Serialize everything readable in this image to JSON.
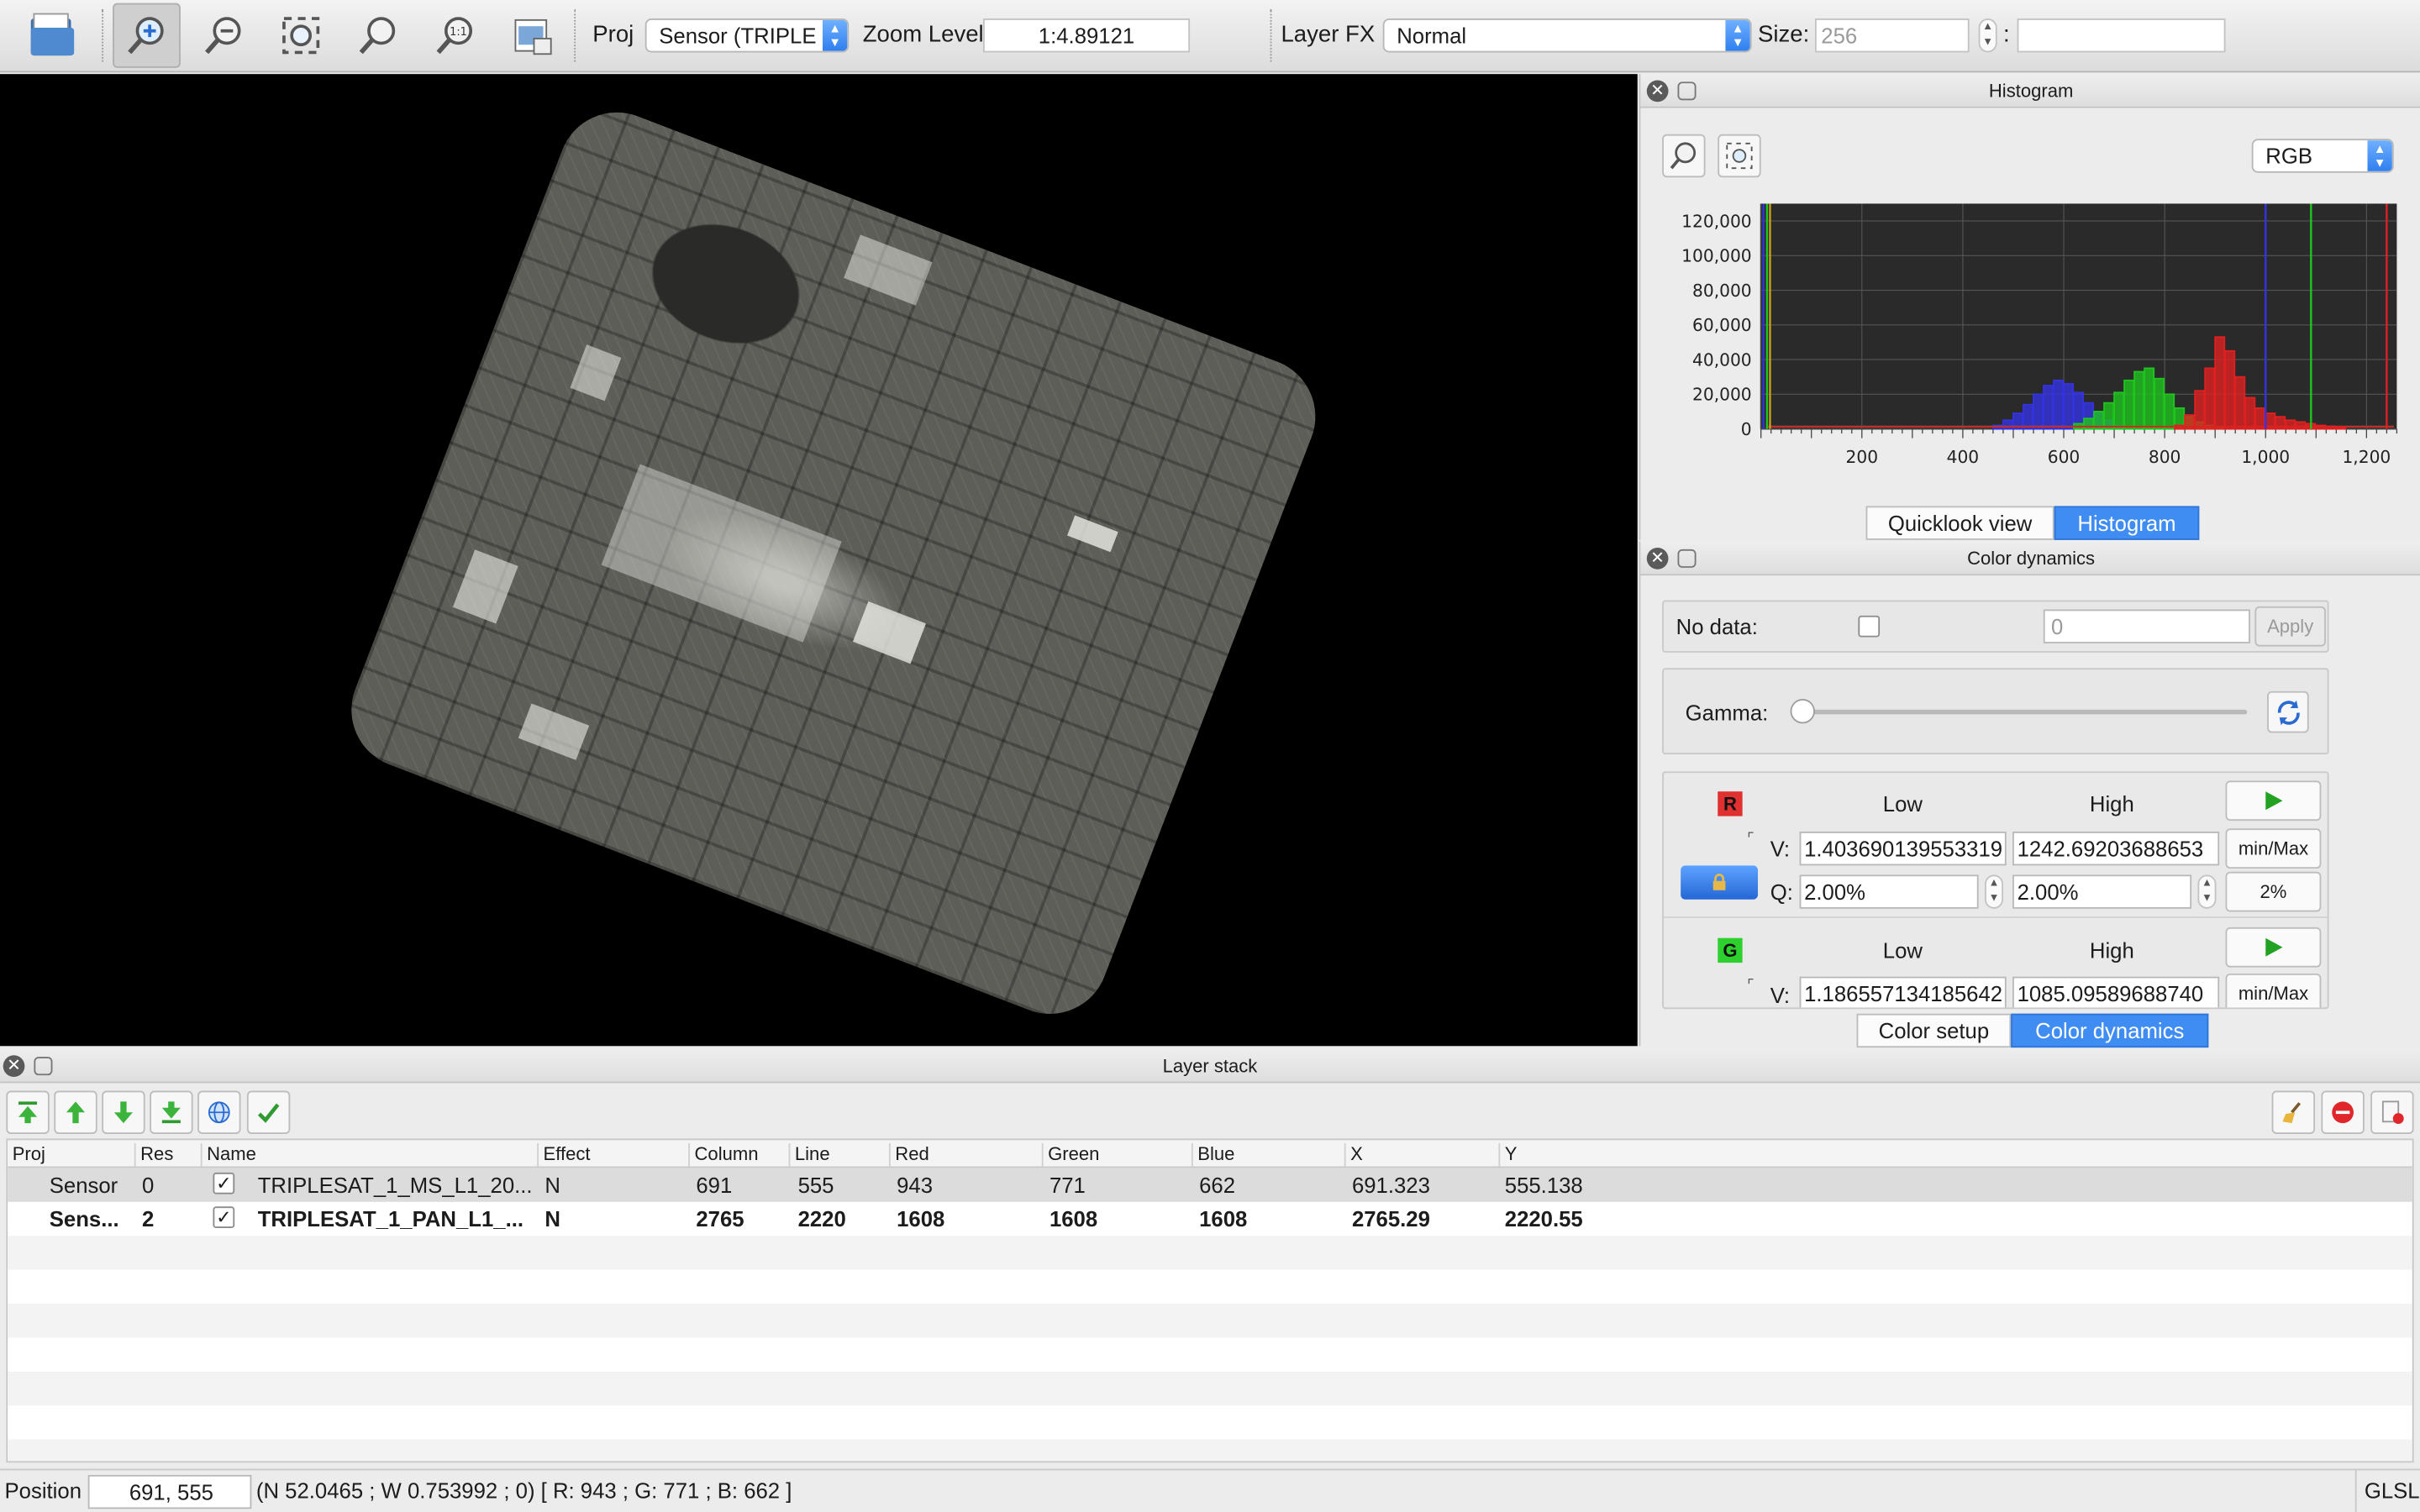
{
  "toolbar": {
    "proj_label": "Proj",
    "proj_value": "Sensor (TRIPLE",
    "zoom_label": "Zoom Level",
    "zoom_value": "1:4.89121",
    "layerfx_label": "Layer FX",
    "layerfx_value": "Normal",
    "size_label": "Size:",
    "size_value": "256",
    "size_sep": ":",
    "size_value2": ""
  },
  "histogram": {
    "title": "Histogram",
    "mode": "RGB",
    "y_ticks": [
      "120,000",
      "100,000",
      "80,000",
      "60,000",
      "40,000",
      "20,000",
      "0"
    ],
    "x_ticks": [
      "200",
      "400",
      "600",
      "800",
      "1,000",
      "1,200"
    ],
    "tabs": [
      "Quicklook view",
      "Histogram"
    ],
    "active_tab": "Histogram",
    "colors": {
      "red": "#e02020",
      "green": "#1fc41f",
      "blue": "#3333e0"
    }
  },
  "chart_data": {
    "type": "bar",
    "xlim": [
      0,
      1260
    ],
    "ylim": [
      0,
      130000
    ],
    "series": [
      {
        "name": "R",
        "x": [
          820,
          840,
          860,
          880,
          900,
          920,
          940,
          960,
          980,
          1000,
          1020,
          1040,
          1060,
          1080,
          1100,
          1120,
          1140
        ],
        "values": [
          2000,
          8000,
          22000,
          35000,
          53000,
          45000,
          30000,
          18000,
          12000,
          9000,
          7000,
          5000,
          4000,
          3000,
          2000,
          1500,
          1000
        ]
      },
      {
        "name": "G",
        "x": [
          620,
          640,
          660,
          680,
          700,
          720,
          740,
          760,
          780,
          800,
          820,
          840,
          860,
          880,
          900
        ],
        "values": [
          3000,
          6000,
          10000,
          15000,
          21000,
          28000,
          33000,
          35000,
          29000,
          20000,
          12000,
          7000,
          4000,
          2000,
          1000
        ]
      },
      {
        "name": "B",
        "x": [
          460,
          480,
          500,
          520,
          540,
          560,
          580,
          600,
          620,
          640,
          660,
          680,
          700
        ],
        "values": [
          2000,
          5000,
          9000,
          14000,
          20000,
          25000,
          28000,
          26000,
          21000,
          15000,
          9000,
          5000,
          2000
        ]
      }
    ]
  },
  "color_dynamics": {
    "title": "Color dynamics",
    "no_data_label": "No data:",
    "no_data_value": "0",
    "apply_label": "Apply",
    "gamma_label": "Gamma:",
    "low_label": "Low",
    "high_label": "High",
    "red": {
      "badge": "R",
      "v_label": "V:",
      "low_v": "1.403690139553319",
      "high_v": "1242.69203688653",
      "q_label": "Q:",
      "low_q": "2.00%",
      "high_q": "2.00%",
      "minmax": "min/Max",
      "pct": "2%"
    },
    "green": {
      "badge": "G",
      "v_label": "V:",
      "low_v": "1.186557134185642",
      "high_v": "1085.09589688740",
      "minmax": "min/Max"
    },
    "tabs": [
      "Color setup",
      "Color dynamics"
    ],
    "active_tab": "Color dynamics"
  },
  "layer_stack": {
    "title": "Layer stack",
    "columns": [
      "Proj",
      "Res",
      "Name",
      "Effect",
      "Column",
      "Line",
      "Red",
      "Green",
      "Blue",
      "X",
      "Y"
    ],
    "rows": [
      {
        "proj": "Sensor",
        "res": "0",
        "checked": true,
        "name": "TRIPLESAT_1_MS_L1_20...",
        "effect": "N",
        "column": "691",
        "line": "555",
        "red": "943",
        "green": "771",
        "blue": "662",
        "x": "691.323",
        "y": "555.138"
      },
      {
        "proj": "Sens...",
        "res": "2",
        "checked": true,
        "name": "TRIPLESAT_1_PAN_L1_...",
        "effect": "N",
        "column": "2765",
        "line": "2220",
        "red": "1608",
        "green": "1608",
        "blue": "1608",
        "x": "2765.29",
        "y": "2220.55"
      }
    ]
  },
  "status": {
    "position_label": "Position",
    "position_value": "691, 555",
    "info": "(N 52.0465 ; W 0.753992 ; 0) [ R: 943 ; G: 771 ; B: 662 ]",
    "renderer": "GLSL"
  }
}
